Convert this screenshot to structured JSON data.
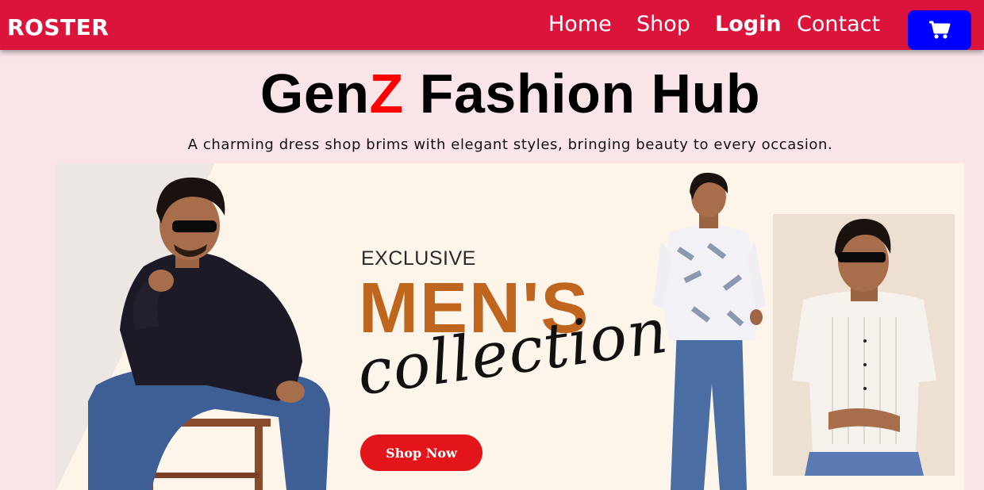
{
  "nav": {
    "brand": "ROSTER",
    "links": [
      "Home",
      "Shop",
      "Login",
      "Contact"
    ],
    "cart_icon": "shopping-cart-icon",
    "color": "#dc143c",
    "cart_color": "#0000ff"
  },
  "hero": {
    "title_prefix": "Gen",
    "title_highlight": "Z",
    "title_suffix": " Fashion Hub",
    "subtitle": "A charming dress shop brims with elegant styles, bringing beauty to every occasion."
  },
  "banner": {
    "kicker": "EXCLUSIVE",
    "headline": "MEN'S",
    "script": "collection",
    "cta": "Shop Now",
    "accent": "#c0651e",
    "cta_color": "#e3151a"
  }
}
